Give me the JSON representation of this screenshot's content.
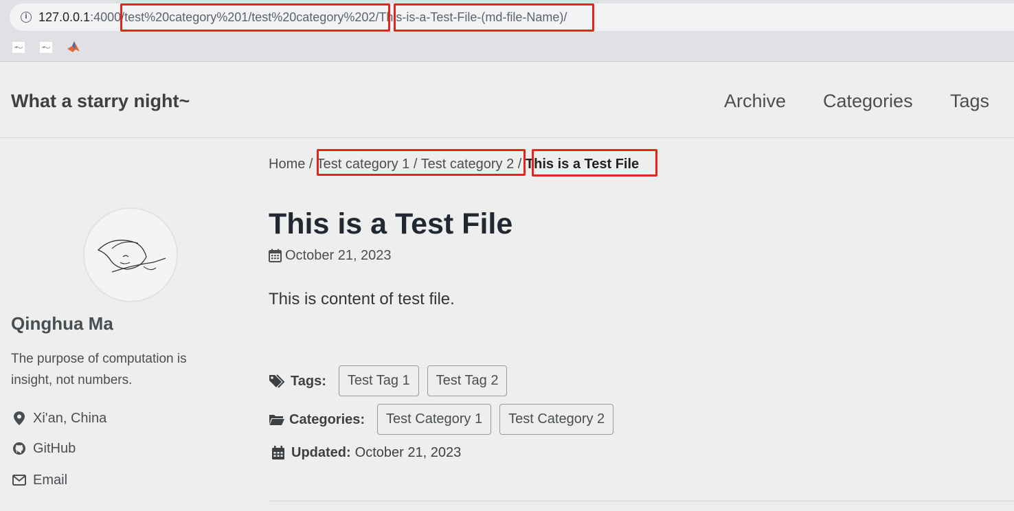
{
  "browser": {
    "url_host": "127.0.0.1",
    "url_port": ":4000",
    "url_path_categories": "/test%20category%201/test%20category%202",
    "url_sep": "/",
    "url_path_file": "This-is-a-Test-File-(md-file-Name)/",
    "info_icon": "info-icon",
    "bookmarks": [
      "bookmark-icon",
      "bookmark-icon",
      "matlab-icon"
    ]
  },
  "header": {
    "site_title": "What a starry night~",
    "nav": [
      "Archive",
      "Categories",
      "Tags"
    ]
  },
  "sidebar": {
    "author_name": "Qinghua Ma",
    "bio": "The purpose of computation is insight, not numbers.",
    "links": [
      {
        "icon": "map-marker-icon",
        "label": "Xi'an, China"
      },
      {
        "icon": "github-icon",
        "label": "GitHub"
      },
      {
        "icon": "envelope-icon",
        "label": "Email"
      }
    ]
  },
  "breadcrumb": {
    "home": "Home",
    "sep": " / ",
    "cat1": "Test category 1",
    "cat2": "Test category 2",
    "current": "This is a Test File"
  },
  "post": {
    "title": "This is a Test File",
    "date": "October 21, 2023",
    "content": "This is content of test file."
  },
  "meta": {
    "tags_label": "Tags:",
    "tags": [
      "Test Tag 1",
      "Test Tag 2"
    ],
    "categories_label": "Categories:",
    "categories": [
      "Test Category 1",
      "Test Category 2"
    ],
    "updated_label": "Updated:",
    "updated_date": "October 21, 2023"
  },
  "colors": {
    "highlight": "#e8231c",
    "page_bg": "#eeeeee",
    "text": "#494e52"
  }
}
